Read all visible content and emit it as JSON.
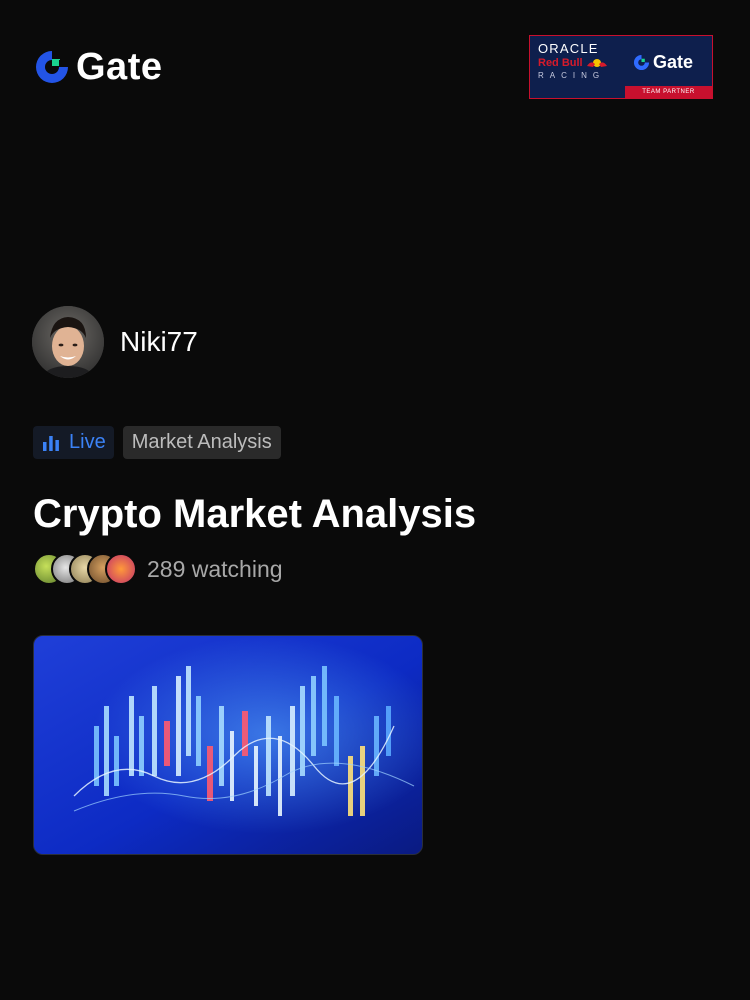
{
  "header": {
    "logo_text": "Gate",
    "logo_color": "#2354e6",
    "partner": {
      "line1": "ORACLE",
      "line2": "Red Bull",
      "line3": "RACING",
      "brand": "Gate",
      "strip": "TEAM PARTNER"
    }
  },
  "host": {
    "name": "Niki77",
    "avatar_icon": "host-avatar"
  },
  "tags": {
    "live_label": "Live",
    "live_color": "#3b82f6",
    "category": "Market Analysis"
  },
  "stream": {
    "title": "Crypto Market Analysis",
    "watching": "289 watching",
    "thumbnail_icon": "candlestick-chart-thumbnail"
  }
}
